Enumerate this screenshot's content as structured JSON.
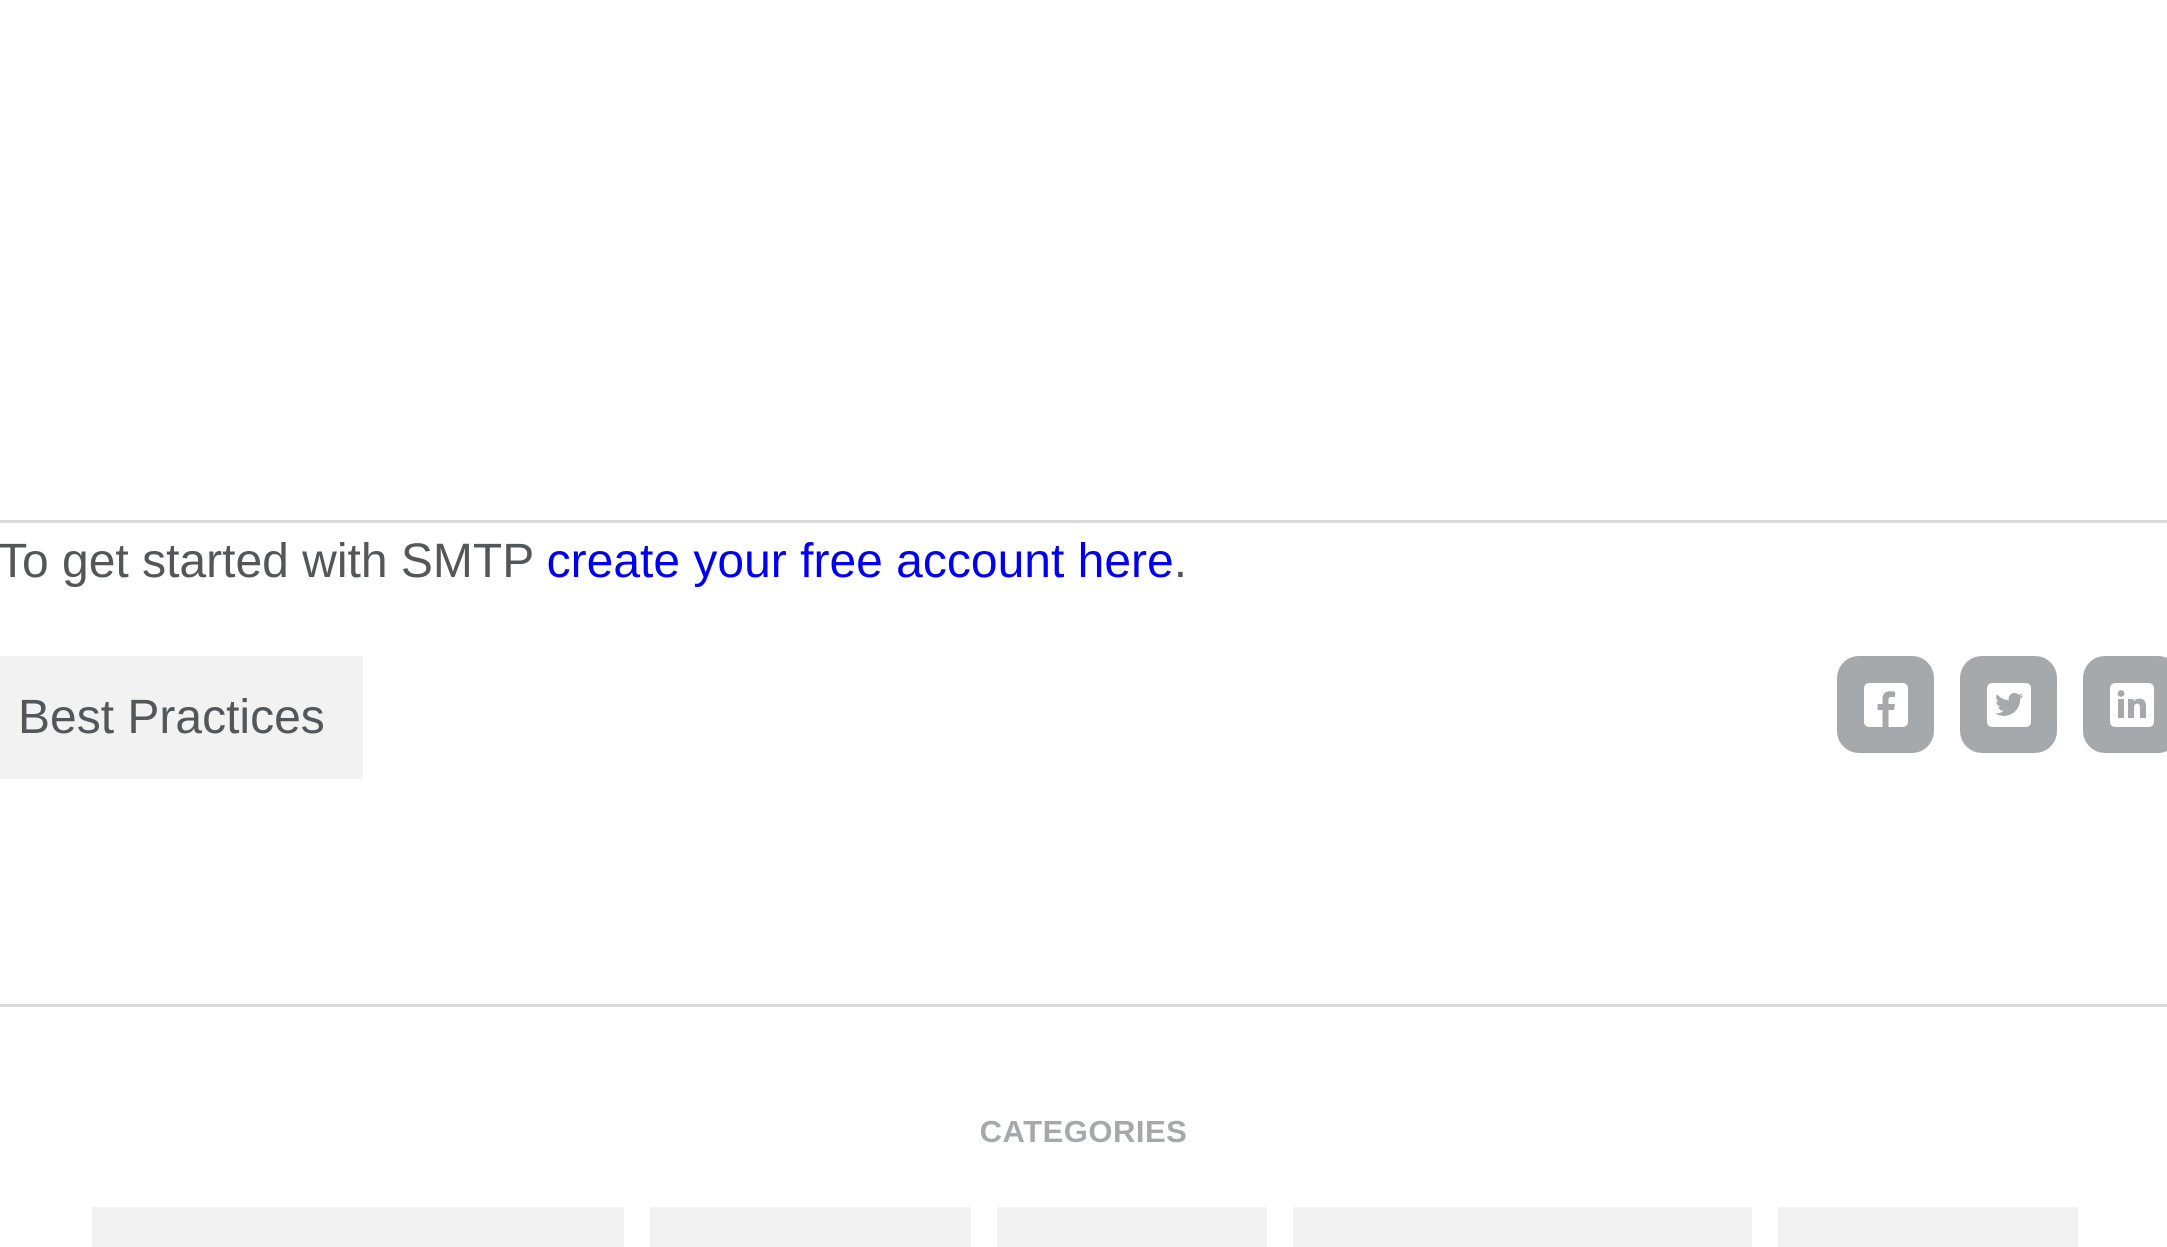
{
  "cta": {
    "prefix": "To get started with SMTP ",
    "link_text": "create your free account here",
    "suffix": "."
  },
  "tag": {
    "label": "Best Practices"
  },
  "share": {
    "icons": [
      "facebook-icon",
      "twitter-icon",
      "linkedin-icon"
    ],
    "background_color": "#a6a9ac"
  },
  "categories": {
    "heading": "CATEGORIES"
  },
  "colors": {
    "text": "#53575a",
    "link": "#0000ee",
    "muted": "#a6a9ac",
    "tag_bg": "#f2f2f2",
    "divider": "#d9d9d9"
  }
}
